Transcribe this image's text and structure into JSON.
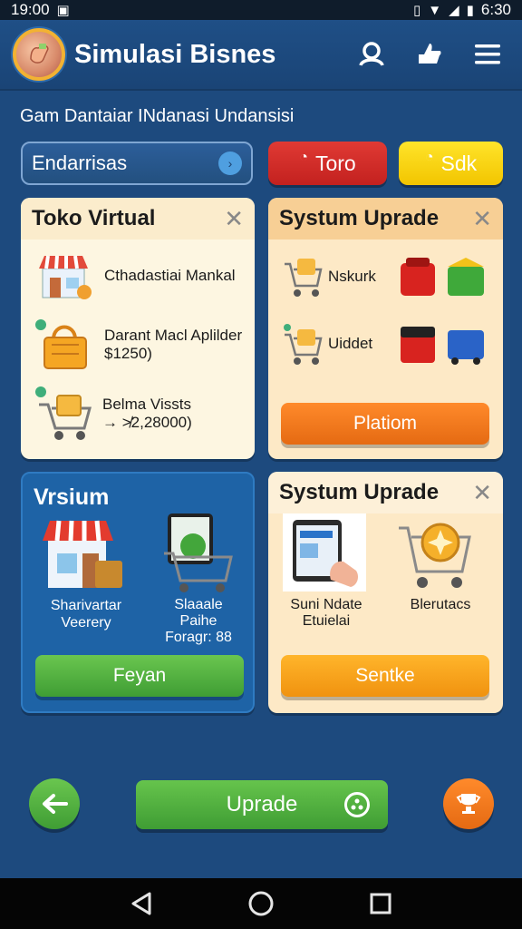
{
  "status_bar": {
    "time_left": "19:00",
    "time_right": "6:30"
  },
  "header": {
    "title": "Simulasi Bisnes"
  },
  "subtitle": "Gam Dantaiar INdanasi Undansisi",
  "filters": {
    "dropdown_value": "Endarrisas",
    "red_label": "Toro",
    "yellow_label": "Sdk"
  },
  "card_toko": {
    "title": "Toko Virtual",
    "rows": [
      {
        "line1": "Cthadastiai Mankal",
        "line2": ""
      },
      {
        "line1": "Darant Macl Aplilder",
        "line2": "$1250)"
      },
      {
        "line1": "Belma Vissts",
        "line2": "→ ≯2,28000)"
      }
    ]
  },
  "card_systum1": {
    "title": "Systum Uprade",
    "rows": [
      {
        "label": "Nskurk"
      },
      {
        "label": "Uiddet"
      }
    ],
    "button": "Platiom"
  },
  "card_vrsium": {
    "title": "Vrsium",
    "item1": {
      "line1": "Sharivartar",
      "line2": "Veerery"
    },
    "item2": {
      "line1": "Slaaale",
      "line2": "Paihe",
      "line3": "Foragr: 88"
    },
    "button": "Feyan"
  },
  "card_systum2": {
    "title": "Systum Uprade",
    "item1": {
      "line1": "Suni Ndate",
      "line2": "Etuielai"
    },
    "item2": {
      "line1": "Blerutacs"
    },
    "button": "Sentke"
  },
  "bottom": {
    "upgrade_label": "Uprade"
  },
  "colors": {
    "background": "#1d4a7e",
    "accent_orange": "#ff8a2b",
    "accent_green": "#4fb03e"
  }
}
